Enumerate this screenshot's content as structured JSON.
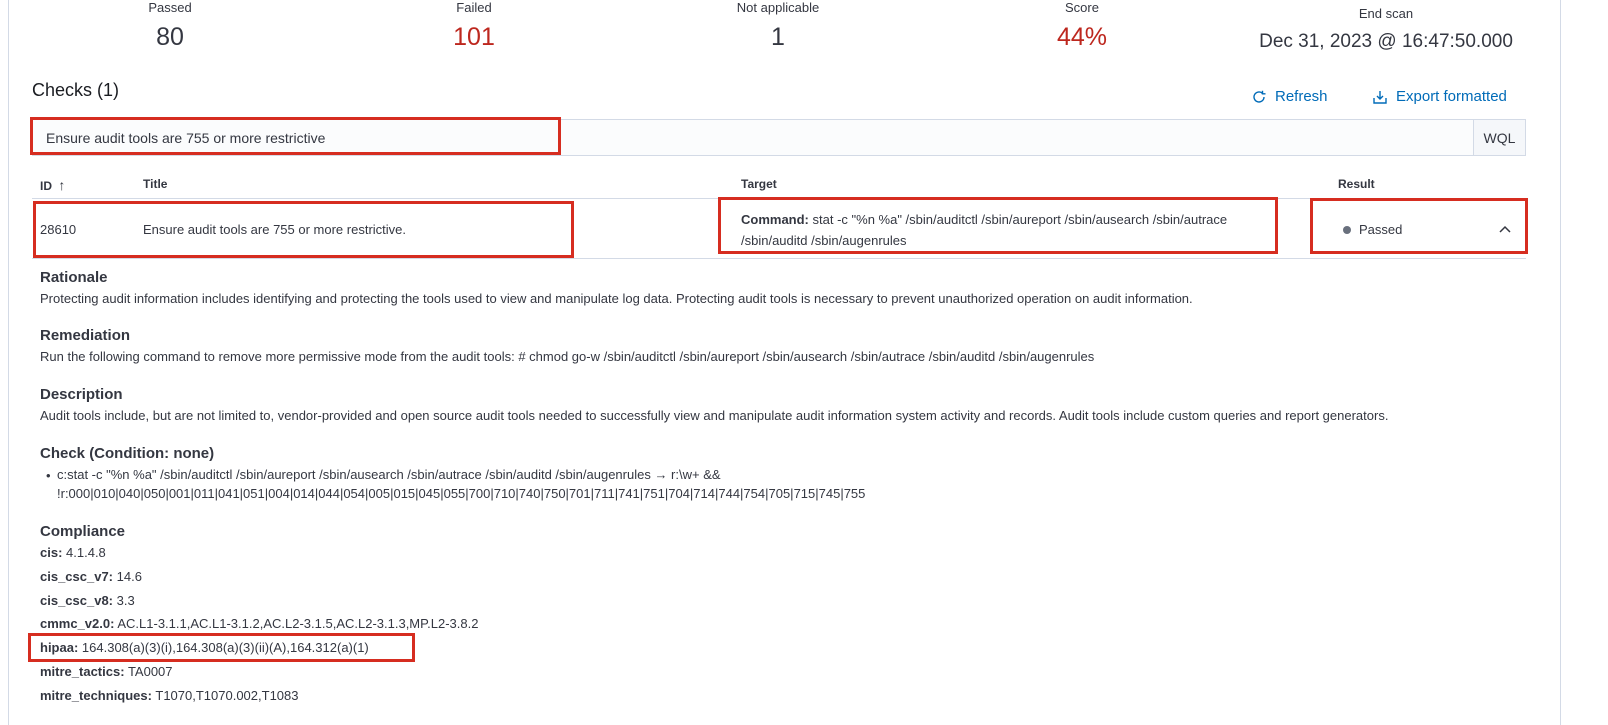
{
  "stats": [
    {
      "label": "Passed",
      "value": "80"
    },
    {
      "label": "Failed",
      "value": "101"
    },
    {
      "label": "Not applicable",
      "value": "1"
    },
    {
      "label": "Score",
      "value": "44%"
    },
    {
      "label": "End scan",
      "value": "Dec 31, 2023 @ 16:47:50.000"
    }
  ],
  "checks": {
    "title": "Checks (1)",
    "refresh_label": "Refresh",
    "export_label": "Export formatted",
    "search_value": "Ensure audit tools are 755 or more restrictive",
    "wql_label": "WQL"
  },
  "table": {
    "headers": {
      "id": "ID",
      "sort_arrow": "↑",
      "title": "Title",
      "target": "Target",
      "result": "Result"
    },
    "row": {
      "id": "28610",
      "title": "Ensure audit tools are 755 or more restrictive.",
      "target_label": "Command:",
      "target_value": "stat -c \"%n %a\" /sbin/auditctl /sbin/aureport /sbin/ausearch /sbin/autrace /sbin/auditd /sbin/augenrules",
      "result": "Passed"
    }
  },
  "details": {
    "rationale_title": "Rationale",
    "rationale_text": "Protecting audit information includes identifying and protecting the tools used to view and manipulate log data. Protecting audit tools is necessary to prevent unauthorized operation on audit information.",
    "remediation_title": "Remediation",
    "remediation_text": "Run the following command to remove more permissive mode from the audit tools: # chmod go-w /sbin/auditctl /sbin/aureport /sbin/ausearch /sbin/autrace /sbin/auditd /sbin/augenrules",
    "description_title": "Description",
    "description_text": "Audit tools include, but are not limited to, vendor-provided and open source audit tools needed to successfully view and manipulate audit information system activity and records. Audit tools include custom queries and report generators.",
    "check_title": "Check (Condition: none)",
    "check_line1": "c:stat -c \"%n %a\" /sbin/auditctl /sbin/aureport /sbin/ausearch /sbin/autrace /sbin/auditd /sbin/augenrules → r:\\w+ &&",
    "check_line2": "!r:000|010|040|050|001|011|041|051|004|014|044|054|005|015|045|055|700|710|740|750|701|711|741|751|704|714|744|754|705|715|745|755",
    "compliance_title": "Compliance",
    "compliance": [
      {
        "key": "cis:",
        "value": "4.1.4.8"
      },
      {
        "key": "cis_csc_v7:",
        "value": "14.6"
      },
      {
        "key": "cis_csc_v8:",
        "value": "3.3"
      },
      {
        "key": "cmmc_v2.0:",
        "value": "AC.L1-3.1.1,AC.L1-3.1.2,AC.L2-3.1.5,AC.L2-3.1.3,MP.L2-3.8.2"
      },
      {
        "key": "hipaa:",
        "value": "164.308(a)(3)(i),164.308(a)(3)(ii)(A),164.312(a)(1)"
      },
      {
        "key": "mitre_tactics:",
        "value": "TA0007"
      },
      {
        "key": "mitre_techniques:",
        "value": "T1070,T1070.002,T1083"
      }
    ]
  },
  "colors": {
    "failed": "#bd271e",
    "link": "#006bb8",
    "highlight": "#d62d20"
  }
}
